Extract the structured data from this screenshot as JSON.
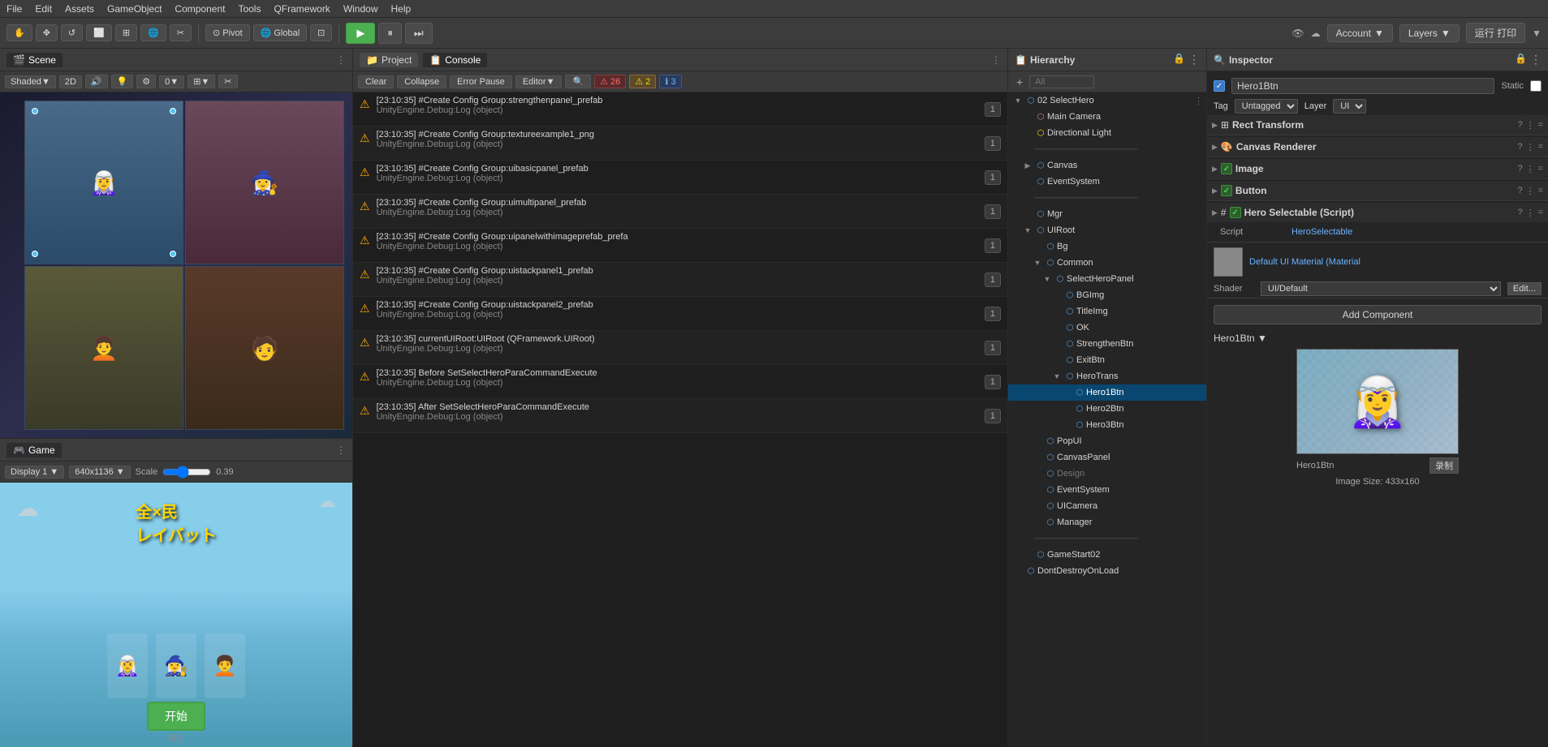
{
  "menu": {
    "items": [
      "File",
      "Edit",
      "Assets",
      "GameObject",
      "Component",
      "Tools",
      "QFramework",
      "Window",
      "Help"
    ]
  },
  "toolbar": {
    "tools": [
      "✋",
      "✥",
      "↺",
      "⬜",
      "⊞",
      "🌐",
      "✂"
    ],
    "pivot_label": "Pivot",
    "global_label": "Global",
    "icon5_label": "⊡",
    "play_label": "▶",
    "pause_label": "⏸",
    "step_label": "⏭",
    "account_label": "Account",
    "layers_label": "Layers",
    "chinese_label": "运行 打印",
    "cloud_icon": "☁",
    "eye_icon": "👁"
  },
  "scene_panel": {
    "title": "Scene",
    "toolbar_items": [
      "Shaded",
      "2D",
      "🔊",
      "💡",
      "⚙",
      "0",
      "⊞",
      "✂"
    ],
    "shaded_label": "Shaded"
  },
  "game_panel": {
    "title": "Game",
    "display_label": "Display 1",
    "resolution_label": "640x1136",
    "scale_label": "Scale",
    "scale_value": "0.39",
    "game_title_chinese": "全×民\nレイバット",
    "start_btn": "开始",
    "bottom_label": "按住"
  },
  "console_panel": {
    "project_tab": "Project",
    "console_tab": "Console",
    "clear_label": "Clear",
    "collapse_label": "Collapse",
    "error_pause_label": "Error Pause",
    "editor_label": "Editor",
    "error_count": "26",
    "warn_count": "2",
    "info_count": "3",
    "entries": [
      {
        "time": "[23:10:35]",
        "line1": "#Create Config Group:strengthenpanel_prefab",
        "line2": "UnityEngine.Debug:Log (object)",
        "count": "1"
      },
      {
        "time": "[23:10:35]",
        "line1": "#Create Config Group:textureexample1_png",
        "line2": "UnityEngine.Debug:Log (object)",
        "count": "1"
      },
      {
        "time": "[23:10:35]",
        "line1": "#Create Config Group:uibasicpanel_prefab",
        "line2": "UnityEngine.Debug:Log (object)",
        "count": "1"
      },
      {
        "time": "[23:10:35]",
        "line1": "#Create Config Group:uimultipanel_prefab",
        "line2": "UnityEngine.Debug:Log (object)",
        "count": "1"
      },
      {
        "time": "[23:10:35]",
        "line1": "#Create Config Group:uipanelwithimageprefab_prefa",
        "line2": "UnityEngine.Debug:Log (object)",
        "count": "1"
      },
      {
        "time": "[23:10:35]",
        "line1": "#Create Config Group:uistackpanel1_prefab",
        "line2": "UnityEngine.Debug:Log (object)",
        "count": "1"
      },
      {
        "time": "[23:10:35]",
        "line1": "#Create Config Group:uistackpanel2_prefab",
        "line2": "UnityEngine.Debug:Log (object)",
        "count": "1"
      },
      {
        "time": "[23:10:35]",
        "line1": "currentUIRoot:UIRoot (QFramework.UIRoot)",
        "line2": "UnityEngine.Debug:Log (object)",
        "count": "1"
      },
      {
        "time": "[23:10:35]",
        "line1": "Before SetSelectHeroParaCommandExecute",
        "line2": "UnityEngine.Debug:Log (object)",
        "count": "1"
      },
      {
        "time": "[23:10:35]",
        "line1": "After SetSelectHeroParaCommandExecute",
        "line2": "UnityEngine.Debug:Log (object)",
        "count": "1"
      }
    ]
  },
  "hierarchy": {
    "title": "Hierarchy",
    "search_placeholder": "All",
    "root": "02 SelectHero",
    "items": [
      {
        "label": "Main Camera",
        "indent": 1,
        "icon": "cam",
        "has_children": false
      },
      {
        "label": "Directional Light",
        "indent": 1,
        "icon": "light",
        "has_children": false
      },
      {
        "label": "--------",
        "indent": 1,
        "icon": "",
        "separator": true
      },
      {
        "label": "Canvas",
        "indent": 1,
        "icon": "cube",
        "has_children": true,
        "expanded": false
      },
      {
        "label": "EventSystem",
        "indent": 1,
        "icon": "cube",
        "has_children": false
      },
      {
        "label": "--------",
        "indent": 1,
        "icon": "",
        "separator": true
      },
      {
        "label": "Mgr",
        "indent": 1,
        "icon": "cube",
        "has_children": false
      },
      {
        "label": "UIRoot",
        "indent": 1,
        "icon": "cube",
        "has_children": true,
        "expanded": true
      },
      {
        "label": "Bg",
        "indent": 2,
        "icon": "cube",
        "has_children": false
      },
      {
        "label": "Common",
        "indent": 2,
        "icon": "cube",
        "has_children": true,
        "expanded": true
      },
      {
        "label": "SelectHeroPanel",
        "indent": 3,
        "icon": "cube",
        "has_children": true,
        "expanded": true
      },
      {
        "label": "BGImg",
        "indent": 4,
        "icon": "cube",
        "has_children": false
      },
      {
        "label": "TitleImg",
        "indent": 4,
        "icon": "cube",
        "has_children": false
      },
      {
        "label": "OK",
        "indent": 4,
        "icon": "cube",
        "has_children": false
      },
      {
        "label": "StrengthenBtn",
        "indent": 4,
        "icon": "cube",
        "has_children": false
      },
      {
        "label": "ExitBtn",
        "indent": 4,
        "icon": "cube",
        "has_children": false
      },
      {
        "label": "HeroTrans",
        "indent": 4,
        "icon": "cube",
        "has_children": true,
        "expanded": true
      },
      {
        "label": "Hero1Btn",
        "indent": 5,
        "icon": "cube",
        "has_children": false,
        "selected": true
      },
      {
        "label": "Hero2Btn",
        "indent": 5,
        "icon": "cube",
        "has_children": false
      },
      {
        "label": "Hero3Btn",
        "indent": 5,
        "icon": "cube",
        "has_children": false
      },
      {
        "label": "PopUI",
        "indent": 2,
        "icon": "cube",
        "has_children": false
      },
      {
        "label": "CanvasPanel",
        "indent": 2,
        "icon": "cube",
        "has_children": false
      },
      {
        "label": "Design",
        "indent": 2,
        "icon": "cube",
        "has_children": false,
        "dimmed": true
      },
      {
        "label": "EventSystem",
        "indent": 2,
        "icon": "cube",
        "has_children": false
      },
      {
        "label": "UICamera",
        "indent": 2,
        "icon": "cube",
        "has_children": false
      },
      {
        "label": "Manager",
        "indent": 2,
        "icon": "cube",
        "has_children": false
      },
      {
        "label": "--------",
        "indent": 1,
        "icon": "",
        "separator": true
      },
      {
        "label": "GameStart02",
        "indent": 1,
        "icon": "cube",
        "has_children": false
      },
      {
        "label": "DontDestroyOnLoad",
        "indent": 0,
        "icon": "cube",
        "has_children": false
      }
    ]
  },
  "inspector": {
    "title": "Inspector",
    "object_name": "Hero1Btn",
    "static_label": "Static",
    "tag_label": "Tag",
    "tag_value": "Untagged",
    "layer_label": "Layer",
    "layer_value": "UI",
    "components": [
      {
        "name": "Rect Transform",
        "enabled": true,
        "icons": [
          "?",
          "⋮",
          "="
        ]
      },
      {
        "name": "Canvas Renderer",
        "enabled": true,
        "icons": [
          "?",
          "⋮",
          "="
        ]
      },
      {
        "name": "Image",
        "enabled": true,
        "checked": true,
        "icons": [
          "?",
          "⋮",
          "="
        ]
      },
      {
        "name": "Button",
        "enabled": true,
        "checked": true,
        "icons": [
          "?",
          "⋮",
          "="
        ]
      },
      {
        "name": "Hero Selectable (Script)",
        "enabled": true,
        "checked": true,
        "icons": [
          "?",
          "⋮",
          "="
        ],
        "script_field": "HeroSelectable",
        "script_label": "Script"
      }
    ],
    "material_label": "Default UI Material (Material",
    "shader_label": "Shader",
    "shader_value": "UI/Default",
    "edit_label": "Edit...",
    "add_component_label": "Add Component",
    "preview": {
      "dropdown_label": "Hero1Btn ▼",
      "name_label": "Hero1Btn",
      "size_label": "Image Size: 433x160",
      "record_label": "录制"
    }
  }
}
